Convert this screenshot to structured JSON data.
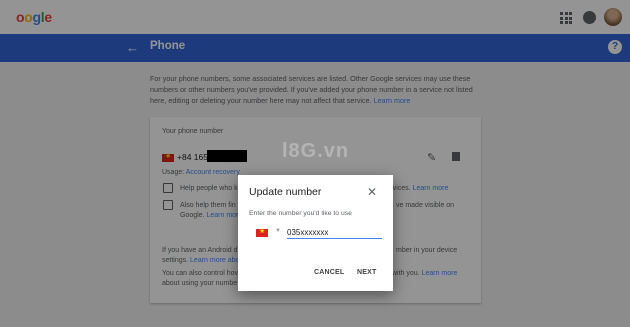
{
  "header": {
    "logo_letters": [
      "o",
      "o",
      "g",
      "l",
      "e"
    ],
    "logo_colors": [
      "#ea4335",
      "#fbbc05",
      "#4285f4",
      "#34a853",
      "#ea4335"
    ]
  },
  "bluebar": {
    "back_icon": "←",
    "title": "Phone",
    "help_icon": "?",
    "color": "#3367d6"
  },
  "intro": {
    "text": "For your phone numbers, some associated services are listed. Other Google services may use these numbers or other numbers you've provided. If you've added your phone number in a service not listed here, editing or deleting your number here may not affect that service.",
    "link": "Learn more"
  },
  "card": {
    "title": "Your phone number",
    "phone_prefix": "+84 165",
    "usage_label": "Usage:",
    "usage_link": "Account recovery",
    "checkbox1_text": "Help people who k",
    "checkbox1_tail": "services.",
    "checkbox1_link": "Learn more",
    "checkbox2_line1": "Also help them fin",
    "checkbox2_tail": "ve made visible on",
    "checkbox2_line2_prefix": "Google.",
    "checkbox2_link": "Learn more",
    "android_line1_start": "If you have an Android d",
    "android_line1_end": "mber in your device",
    "android_line2_start": "settings.",
    "android_line2_link": "Learn more abo",
    "control_line1_start": "You can also control hov",
    "control_line1_end": "with you.",
    "control_line1_link": "Learn more",
    "control_line2_link": "about using your numbe"
  },
  "dialog": {
    "title": "Update number",
    "close_icon": "✕",
    "label": "Enter the number you'd like to use",
    "input_value": "035xxxxxxx",
    "dropdown_icon": "▼",
    "cancel_label": "CANCEL",
    "next_label": "NEXT"
  },
  "watermark": {
    "text": "l8G.vn"
  },
  "icons": {
    "edit": "✎"
  }
}
